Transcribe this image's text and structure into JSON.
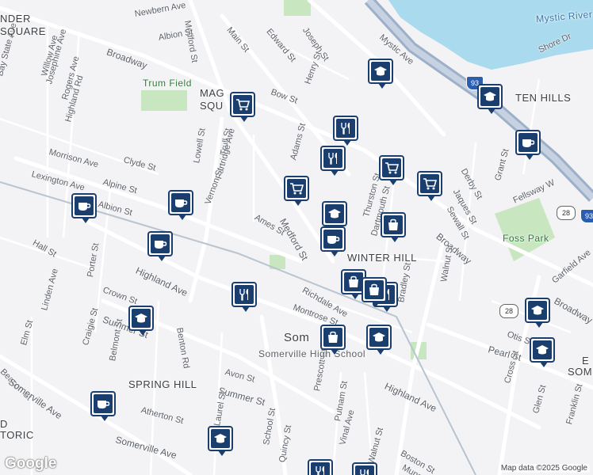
{
  "map": {
    "colors": {
      "background": "#f3f2f4",
      "water": "#aadaee",
      "park": "#c8e6c0",
      "road": "#ffffff",
      "highway": "#9cb0c8",
      "pin": "#1a3f6f"
    },
    "street_labels": [
      {
        "text": "Newbern Ave"
      },
      {
        "text": "Medford St"
      },
      {
        "text": "Albion St"
      },
      {
        "text": "Broadway"
      },
      {
        "text": "Willow Ave"
      },
      {
        "text": "Josephine Ave"
      },
      {
        "text": "Rogers Ave"
      },
      {
        "text": "Highland Rd"
      },
      {
        "text": "Bay State Ave"
      },
      {
        "text": "Main St"
      },
      {
        "text": "Edward St"
      },
      {
        "text": "Joseph St"
      },
      {
        "text": "Mystic Ave"
      },
      {
        "text": "Bow St"
      },
      {
        "text": "Henry St"
      },
      {
        "text": "Shore Dr"
      },
      {
        "text": "Morrison Ave"
      },
      {
        "text": "Clyde St"
      },
      {
        "text": "Lowell St"
      },
      {
        "text": "Trull St"
      },
      {
        "text": "Partridge Ave"
      },
      {
        "text": "Lexington Ave"
      },
      {
        "text": "Alpine St"
      },
      {
        "text": "Albion St"
      },
      {
        "text": "Vernon St"
      },
      {
        "text": "Ames St"
      },
      {
        "text": "Medford St"
      },
      {
        "text": "Adams St"
      },
      {
        "text": "Thurston St"
      },
      {
        "text": "Dartmouth St"
      },
      {
        "text": "Derby St"
      },
      {
        "text": "Jaques St"
      },
      {
        "text": "Sewall St"
      },
      {
        "text": "Grant St"
      },
      {
        "text": "Broadway"
      },
      {
        "text": "Fellsway W"
      },
      {
        "text": "Hall St"
      },
      {
        "text": "Porter St"
      },
      {
        "text": "Highland Ave"
      },
      {
        "text": "Crown St"
      },
      {
        "text": "Linden Ave"
      },
      {
        "text": "Summer St"
      },
      {
        "text": "Craigie St"
      },
      {
        "text": "Belmont St"
      },
      {
        "text": "Benton Rd"
      },
      {
        "text": "Richdale Ave"
      },
      {
        "text": "Montrose St"
      },
      {
        "text": "Bradley St"
      },
      {
        "text": "Walnut St"
      },
      {
        "text": "Garfield Ave"
      },
      {
        "text": "Broadway"
      },
      {
        "text": "Otis St"
      },
      {
        "text": "Pearl St"
      },
      {
        "text": "Cross St"
      },
      {
        "text": "Glen St"
      },
      {
        "text": "Franklin St"
      },
      {
        "text": "Elm St"
      },
      {
        "text": "Beacon St"
      },
      {
        "text": "Somerville Ave"
      },
      {
        "text": "Avon St"
      },
      {
        "text": "Summer St"
      },
      {
        "text": "Atherton St"
      },
      {
        "text": "Laurel St"
      },
      {
        "text": "Somerville Ave"
      },
      {
        "text": "School St"
      },
      {
        "text": "Quincy St"
      },
      {
        "text": "Prescott St"
      },
      {
        "text": "Putnam St"
      },
      {
        "text": "Vinal Ave"
      },
      {
        "text": "Highland Ave"
      },
      {
        "text": "Walnut St"
      },
      {
        "text": "Boston St"
      },
      {
        "text": "Munroe St"
      }
    ],
    "area_labels": [
      {
        "text": "NDER"
      },
      {
        "text": "SQUARE"
      },
      {
        "text": "MAG"
      },
      {
        "text": "SQU"
      },
      {
        "text": "TEN HILLS"
      },
      {
        "text": "WINTER HILL"
      },
      {
        "text": "Som"
      },
      {
        "text": "Somerville High School"
      },
      {
        "text": "SPRING HILL"
      },
      {
        "text": "D"
      },
      {
        "text": "TORIC"
      },
      {
        "text": "Mystic River"
      },
      {
        "text": "Trum Field"
      },
      {
        "text": "Foss Park"
      },
      {
        "text": "E"
      },
      {
        "text": "SOM"
      }
    ],
    "shields": [
      "93",
      "93",
      "28",
      "28"
    ],
    "pins": [
      {
        "type": "cart"
      },
      {
        "type": "cart"
      },
      {
        "type": "cart"
      },
      {
        "type": "cart"
      },
      {
        "type": "school"
      },
      {
        "type": "school"
      },
      {
        "type": "school"
      },
      {
        "type": "school"
      },
      {
        "type": "school"
      },
      {
        "type": "school"
      },
      {
        "type": "school"
      },
      {
        "type": "school"
      },
      {
        "type": "cafe"
      },
      {
        "type": "cafe"
      },
      {
        "type": "cafe"
      },
      {
        "type": "cafe"
      },
      {
        "type": "cafe"
      },
      {
        "type": "cafe"
      },
      {
        "type": "restaurant"
      },
      {
        "type": "restaurant"
      },
      {
        "type": "restaurant"
      },
      {
        "type": "restaurant"
      },
      {
        "type": "restaurant"
      },
      {
        "type": "restaurant"
      },
      {
        "type": "shop"
      },
      {
        "type": "shop"
      },
      {
        "type": "shop"
      },
      {
        "type": "shop"
      }
    ],
    "logo": "Google",
    "attribution": "Map data ©2025 Google"
  }
}
